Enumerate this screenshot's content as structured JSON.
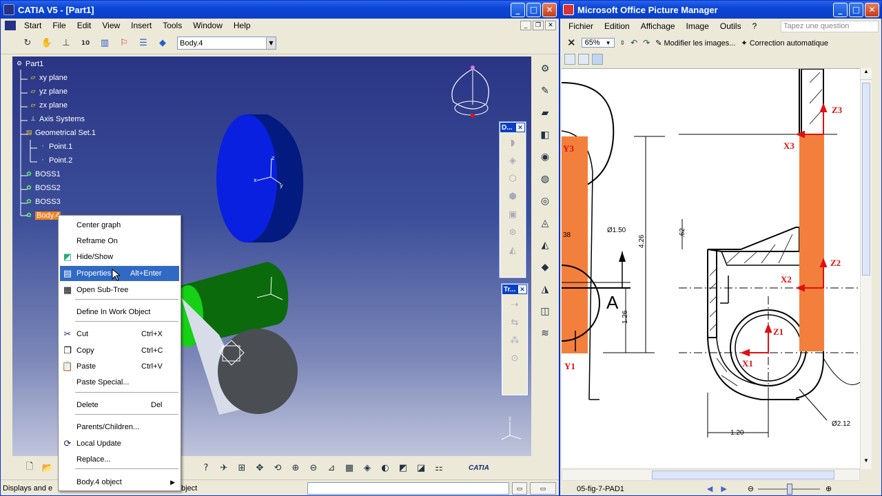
{
  "catia": {
    "title": "CATIA V5 - [Part1]",
    "menu": [
      "Start",
      "File",
      "Edit",
      "View",
      "Insert",
      "Tools",
      "Window",
      "Help"
    ],
    "body_combo": "Body.4",
    "tree": [
      "Part1",
      "xy plane",
      "yz plane",
      "zx plane",
      "Axis Systems",
      "Geometrical Set.1",
      "Point.1",
      "Point.2",
      "BOSS1",
      "BOSS2",
      "BOSS3",
      "Body.4"
    ],
    "panel_d_title": "D...",
    "panel_tr_title": "Tr...",
    "context_menu": [
      {
        "label": "Center graph",
        "shortcut": "",
        "icon": ""
      },
      {
        "label": "Reframe On",
        "shortcut": "",
        "icon": ""
      },
      {
        "label": "Hide/Show",
        "shortcut": "",
        "icon": "hide-show-icon"
      },
      {
        "label": "Properties",
        "shortcut": "Alt+Enter",
        "icon": "properties-icon"
      },
      {
        "label": "Open Sub-Tree",
        "shortcut": "",
        "icon": "subtree-icon"
      },
      {
        "label": "Define In Work Object",
        "shortcut": "",
        "icon": ""
      },
      {
        "label": "Cut",
        "shortcut": "Ctrl+X",
        "icon": "scissors-icon"
      },
      {
        "label": "Copy",
        "shortcut": "Ctrl+C",
        "icon": "copy-icon"
      },
      {
        "label": "Paste",
        "shortcut": "Ctrl+V",
        "icon": "paste-icon"
      },
      {
        "label": "Paste Special...",
        "shortcut": "",
        "icon": ""
      },
      {
        "label": "Delete",
        "shortcut": "Del",
        "icon": ""
      },
      {
        "label": "Parents/Children...",
        "shortcut": "",
        "icon": ""
      },
      {
        "label": "Local Update",
        "shortcut": "",
        "icon": "update-icon"
      },
      {
        "label": "Replace...",
        "shortcut": "",
        "icon": ""
      },
      {
        "label": "Body.4 object",
        "shortcut": "",
        "icon": ""
      }
    ],
    "status_left": "Displays and e",
    "status_right": "bject",
    "logo": "CATIA"
  },
  "picture_manager": {
    "title": "Microsoft Office Picture Manager",
    "menu": [
      "Fichier",
      "Edition",
      "Affichage",
      "Image",
      "Outils",
      "?"
    ],
    "ask_placeholder": "Tapez une question",
    "zoom": "65%",
    "edit_button": "Modifier les images...",
    "auto_button": "Correction automatique",
    "filename": "05-fig-7-PAD1",
    "drawing_labels": {
      "z3": "Z3",
      "x3": "X3",
      "y3": "Y3",
      "z2": "Z2",
      "x2": "X2",
      "z1": "Z1",
      "x1": "X1",
      "y1": "Y1",
      "dia150": "Ø1.50",
      "d426": "4.26",
      "d62": ".62",
      "d126": "1.26",
      "d120": "1.20",
      "dia212": "Ø2.12",
      "d38": "38",
      "section": "A"
    }
  }
}
